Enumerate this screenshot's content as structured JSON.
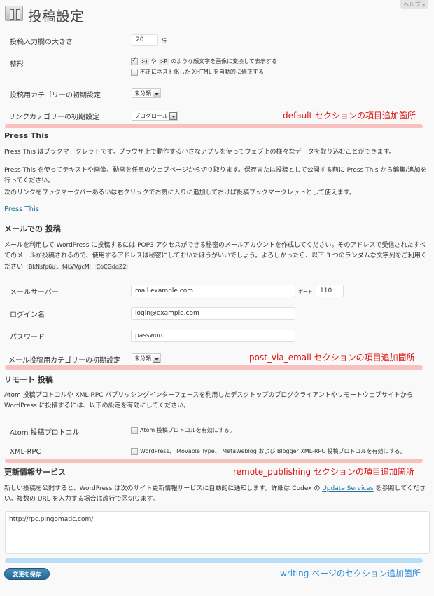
{
  "help": {
    "label": "ヘルプ",
    "arrow": "▼"
  },
  "page": {
    "title": "投稿設定"
  },
  "default_section": {
    "rows": [
      {
        "label": "投稿入力欄の大きさ",
        "value": "20",
        "unit": "行"
      },
      {
        "label": "整形"
      },
      {
        "label": "投稿用カテゴリーの初期設定",
        "value": "未分類"
      },
      {
        "label": "リンクカテゴリーの初期設定",
        "value": "ブログロール"
      }
    ],
    "formatting": {
      "smilies_checked": true,
      "smilies_code1": ":-)",
      "smilies_mid": "や",
      "smilies_code2": ":-P",
      "smilies_text": "のような顔文字を画像に変換して表示する",
      "xhtml_checked": false,
      "xhtml_text": "不正にネスト化した XHTML を自動的に修正する"
    },
    "annotation": "default セクションの項目追加箇所"
  },
  "press_this": {
    "heading": "Press This",
    "p1": "Press This はブックマークレットです。ブラウザ上で動作する小さなアプリを使ってウェブ上の様々なデータを取り込むことができます。",
    "p2": "Press This を使ってテキストや画像、動画を任意のウェブページから切り取ります。保存または投稿として公開する前に Press This から編集/追加を行ってください。",
    "p3": "次のリンクをブックマークバーあるいは右クリックでお気に入りに追加しておけば投稿ブックマークレットとして使えます。",
    "link": "Press This"
  },
  "email": {
    "heading": "メールでの 投稿",
    "desc": "メールを利用して WordPress に投稿するには POP3 アクセスができる秘密のメールアカウントを作成してください。そのアドレスで受信されたすべてのメールが投稿されるので、使用するアドレスは秘密にしておいたほうがいいでしょう。よろしかったら、以下 3 つのランダムな文字列をご利用ください:",
    "random": [
      "BkNsfp6u",
      "f4LVVgcM",
      "CoCGdqZ2"
    ],
    "sep": ",",
    "server_label": "メールサーバー",
    "server_value": "mail.example.com",
    "port_label": "ポート",
    "port_value": "110",
    "login_label": "ログイン名",
    "login_value": "login@example.com",
    "password_label": "パスワード",
    "password_value": "password",
    "category_label": "メール投稿用カテゴリーの初期設定",
    "category_value": "未分類",
    "annotation": "post_via_email セクションの項目追加箇所"
  },
  "remote": {
    "heading": "リモート 投稿",
    "desc": "Atom 投稿プロトコルや XML-RPC パブリッシングインターフェースを利用したデスクトップのブログクライアントやリモートウェブサイトから WordPress に投稿するには、以下の設定を有効にしてください。",
    "atom_label": "Atom 投稿プロトコル",
    "atom_text": "Atom 投稿プロトコルを有効にする。",
    "atom_checked": false,
    "xmlrpc_label": "XML-RPC",
    "xmlrpc_text": "WordPress、 Movable Type、 MetaWeblog および Blogger XML-RPC 投稿プロトコルを有効にする。",
    "xmlrpc_checked": false,
    "annotation": "remote_publishing セクションの項目追加箇所"
  },
  "update_services": {
    "heading": "更新情報サービス",
    "desc_before": "新しい投稿を公開すると、WordPress は次のサイト更新情報サービスに自動的に通知します。詳細は Codex の ",
    "link": "Update Services",
    "desc_after": " を参照してください。複数の URL を入力する場合は改行で区切ります。",
    "textarea_value": "http://rpc.pingomatic.com/"
  },
  "footer": {
    "save_label": "変更を保存",
    "annotation": "writing ページのセクション追加箇所"
  },
  "colors": {
    "annotation_red": "#e01010",
    "annotation_blue": "#2f8fdc",
    "pink_band": "#f9c0c0",
    "blue_band": "#b9dcf7",
    "link": "#21759b"
  }
}
